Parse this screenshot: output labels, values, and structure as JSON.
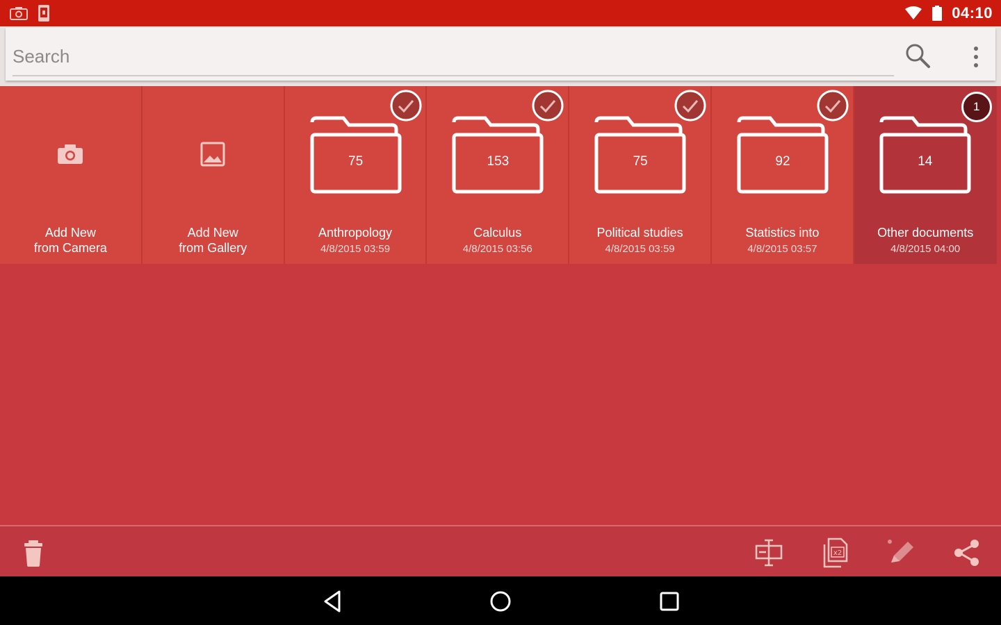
{
  "status_bar": {
    "time": "04:10"
  },
  "search": {
    "placeholder": "Search",
    "value": ""
  },
  "tiles": {
    "camera": {
      "line1": "Add New",
      "line2": "from Camera"
    },
    "gallery": {
      "line1": "Add New",
      "line2": "from Gallery"
    },
    "folders": [
      {
        "name": "Anthropology",
        "date": "4/8/2015 03:59",
        "count": "75",
        "selected": true
      },
      {
        "name": "Calculus",
        "date": "4/8/2015 03:56",
        "count": "153",
        "selected": true
      },
      {
        "name": "Political studies",
        "date": "4/8/2015 03:59",
        "count": "75",
        "selected": true
      },
      {
        "name": "Statistics into",
        "date": "4/8/2015 03:57",
        "count": "92",
        "selected": true
      },
      {
        "name": "Other documents",
        "date": "4/8/2015 04:00",
        "count": "14",
        "badge": "1"
      }
    ]
  },
  "toolbar": {
    "icons": [
      "trash-icon",
      "ocr-icon",
      "copy-x2-icon",
      "edit-pen-icon",
      "share-icon"
    ]
  },
  "colors": {
    "status_bar": "#cc1a0e",
    "background": "#c8383f",
    "tile": "#d3453f",
    "tile_active": "#b3333a",
    "badge": "#5a1316"
  }
}
